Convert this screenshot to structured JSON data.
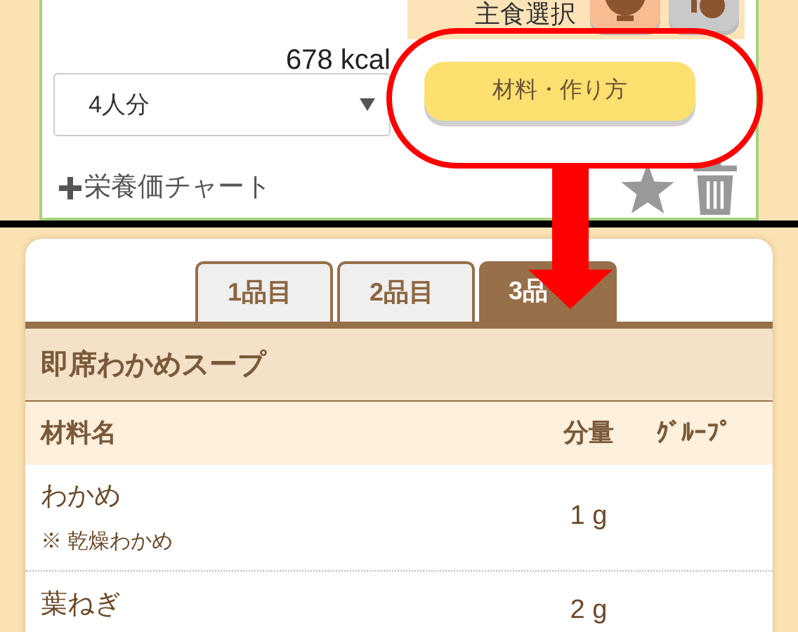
{
  "recipe_card": {
    "staple": {
      "label": "主食選択",
      "options": [
        {
          "kind": "rice",
          "selected": true
        },
        {
          "kind": "bread",
          "selected": false
        }
      ]
    },
    "calories": "678 kcal",
    "servings": "4人分",
    "recipe_button": "材料・作り方",
    "nutrition_link": "栄養価チャート"
  },
  "ingredients": {
    "tabs": [
      {
        "label": "1品目",
        "selected": false
      },
      {
        "label": "2品目",
        "selected": false
      },
      {
        "label": "3品",
        "selected": true
      }
    ],
    "dish_title": "即席わかめスープ",
    "columns": [
      "材料名",
      "分量",
      "ｸﾞﾙｰﾌﾟ"
    ],
    "rows": [
      {
        "name": "わかめ",
        "note": "※ 乾燥わかめ",
        "amount": "1 g"
      },
      {
        "name": "葉ねぎ",
        "amount": "2 g"
      }
    ]
  }
}
